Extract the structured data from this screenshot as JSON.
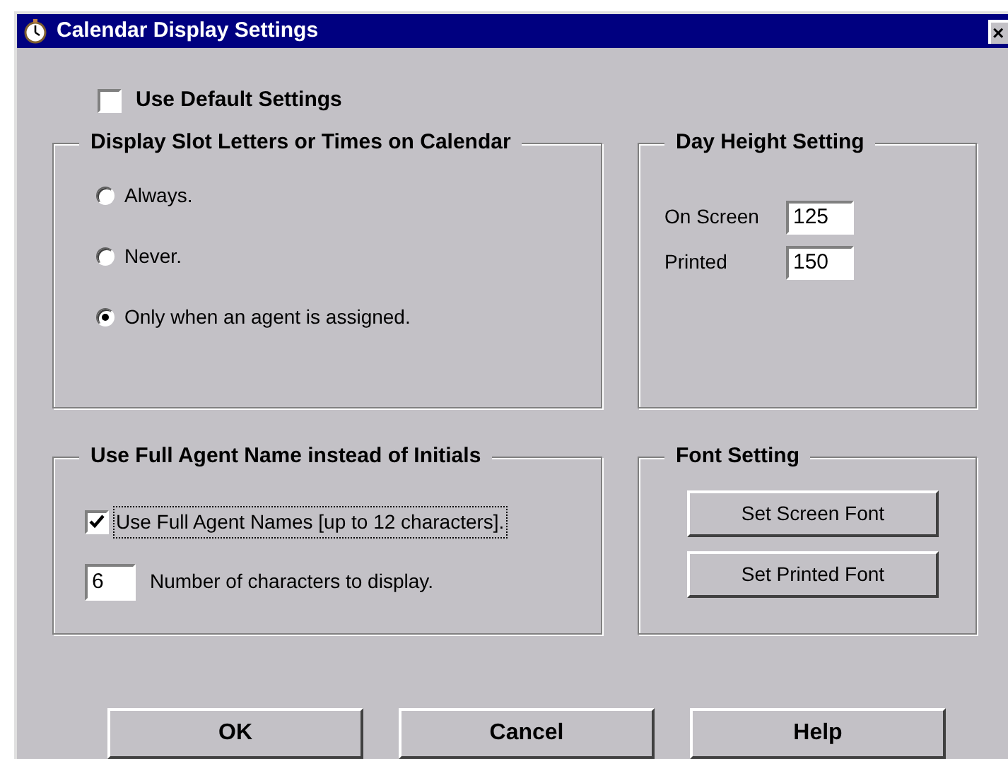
{
  "window": {
    "title": "Calendar Display Settings",
    "close": "×"
  },
  "use_default": {
    "label": "Use Default Settings",
    "checked": false
  },
  "slot_group": {
    "title": "Display Slot Letters or Times on Calendar",
    "options": [
      {
        "label": "Always.",
        "selected": false
      },
      {
        "label": "Never.",
        "selected": false
      },
      {
        "label": "Only when an agent is assigned.",
        "selected": true
      }
    ]
  },
  "day_height": {
    "title": "Day Height Setting",
    "fields": [
      {
        "label": "On Screen",
        "value": "125"
      },
      {
        "label": "Printed",
        "value": "150"
      }
    ]
  },
  "agent_group": {
    "title": "Use Full Agent Name instead of Initials",
    "full_names": {
      "label": "Use Full Agent Names [up to 12 characters].",
      "checked": true
    },
    "count": {
      "value": "6",
      "label": "Number of characters to display."
    }
  },
  "font_group": {
    "title": "Font Setting",
    "buttons": [
      "Set Screen Font",
      "Set Printed Font"
    ]
  },
  "buttons": [
    "OK",
    "Cancel",
    "Help"
  ]
}
